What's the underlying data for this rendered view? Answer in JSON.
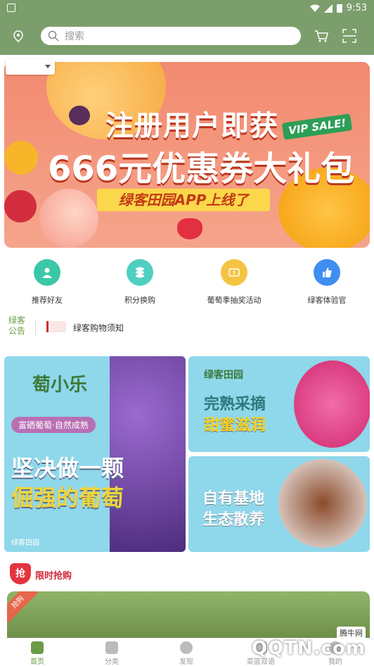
{
  "status_bar": {
    "time": "9:53"
  },
  "header": {
    "search_placeholder": "搜索"
  },
  "banner": {
    "headline": "注册用户即获",
    "subheadline": "666元优惠券大礼包",
    "badge": "VIP SALE!",
    "ribbon": "绿客田园APP上线了"
  },
  "quick_menu": [
    {
      "label": "推荐好友",
      "color": "#3cc7a6"
    },
    {
      "label": "积分换购",
      "color": "#4fcfc2"
    },
    {
      "label": "葡萄季抽奖活动",
      "color": "#f5c342"
    },
    {
      "label": "绿客体验官",
      "color": "#3f8ef0"
    }
  ],
  "notice": {
    "tag_line1": "绿客",
    "tag_line2": "公告",
    "text": "绿客购物须知"
  },
  "promo": {
    "grape": {
      "brand": "萄小乐",
      "pill": "富硒葡萄·自然成熟",
      "line1": "坚决做一颗",
      "line2": "倔强的葡萄",
      "footer": "绿客田园"
    },
    "pitaya": {
      "logo": "绿客田园",
      "line1": "完熟采摘",
      "line2": "甜蜜滋润"
    },
    "chicken": {
      "line1": "自有基地",
      "line2": "生态散养"
    }
  },
  "flash_sale": {
    "badge": "抢",
    "title": "限时抢购",
    "corner": "抢购"
  },
  "tabs": [
    {
      "label": "首页",
      "active": true
    },
    {
      "label": "分类",
      "active": false
    },
    {
      "label": "发现",
      "active": false
    },
    {
      "label": "菜篮双语",
      "active": false
    },
    {
      "label": "我的",
      "active": false
    }
  ],
  "watermark": {
    "top": "腾牛网",
    "main": "QQTN.com"
  }
}
